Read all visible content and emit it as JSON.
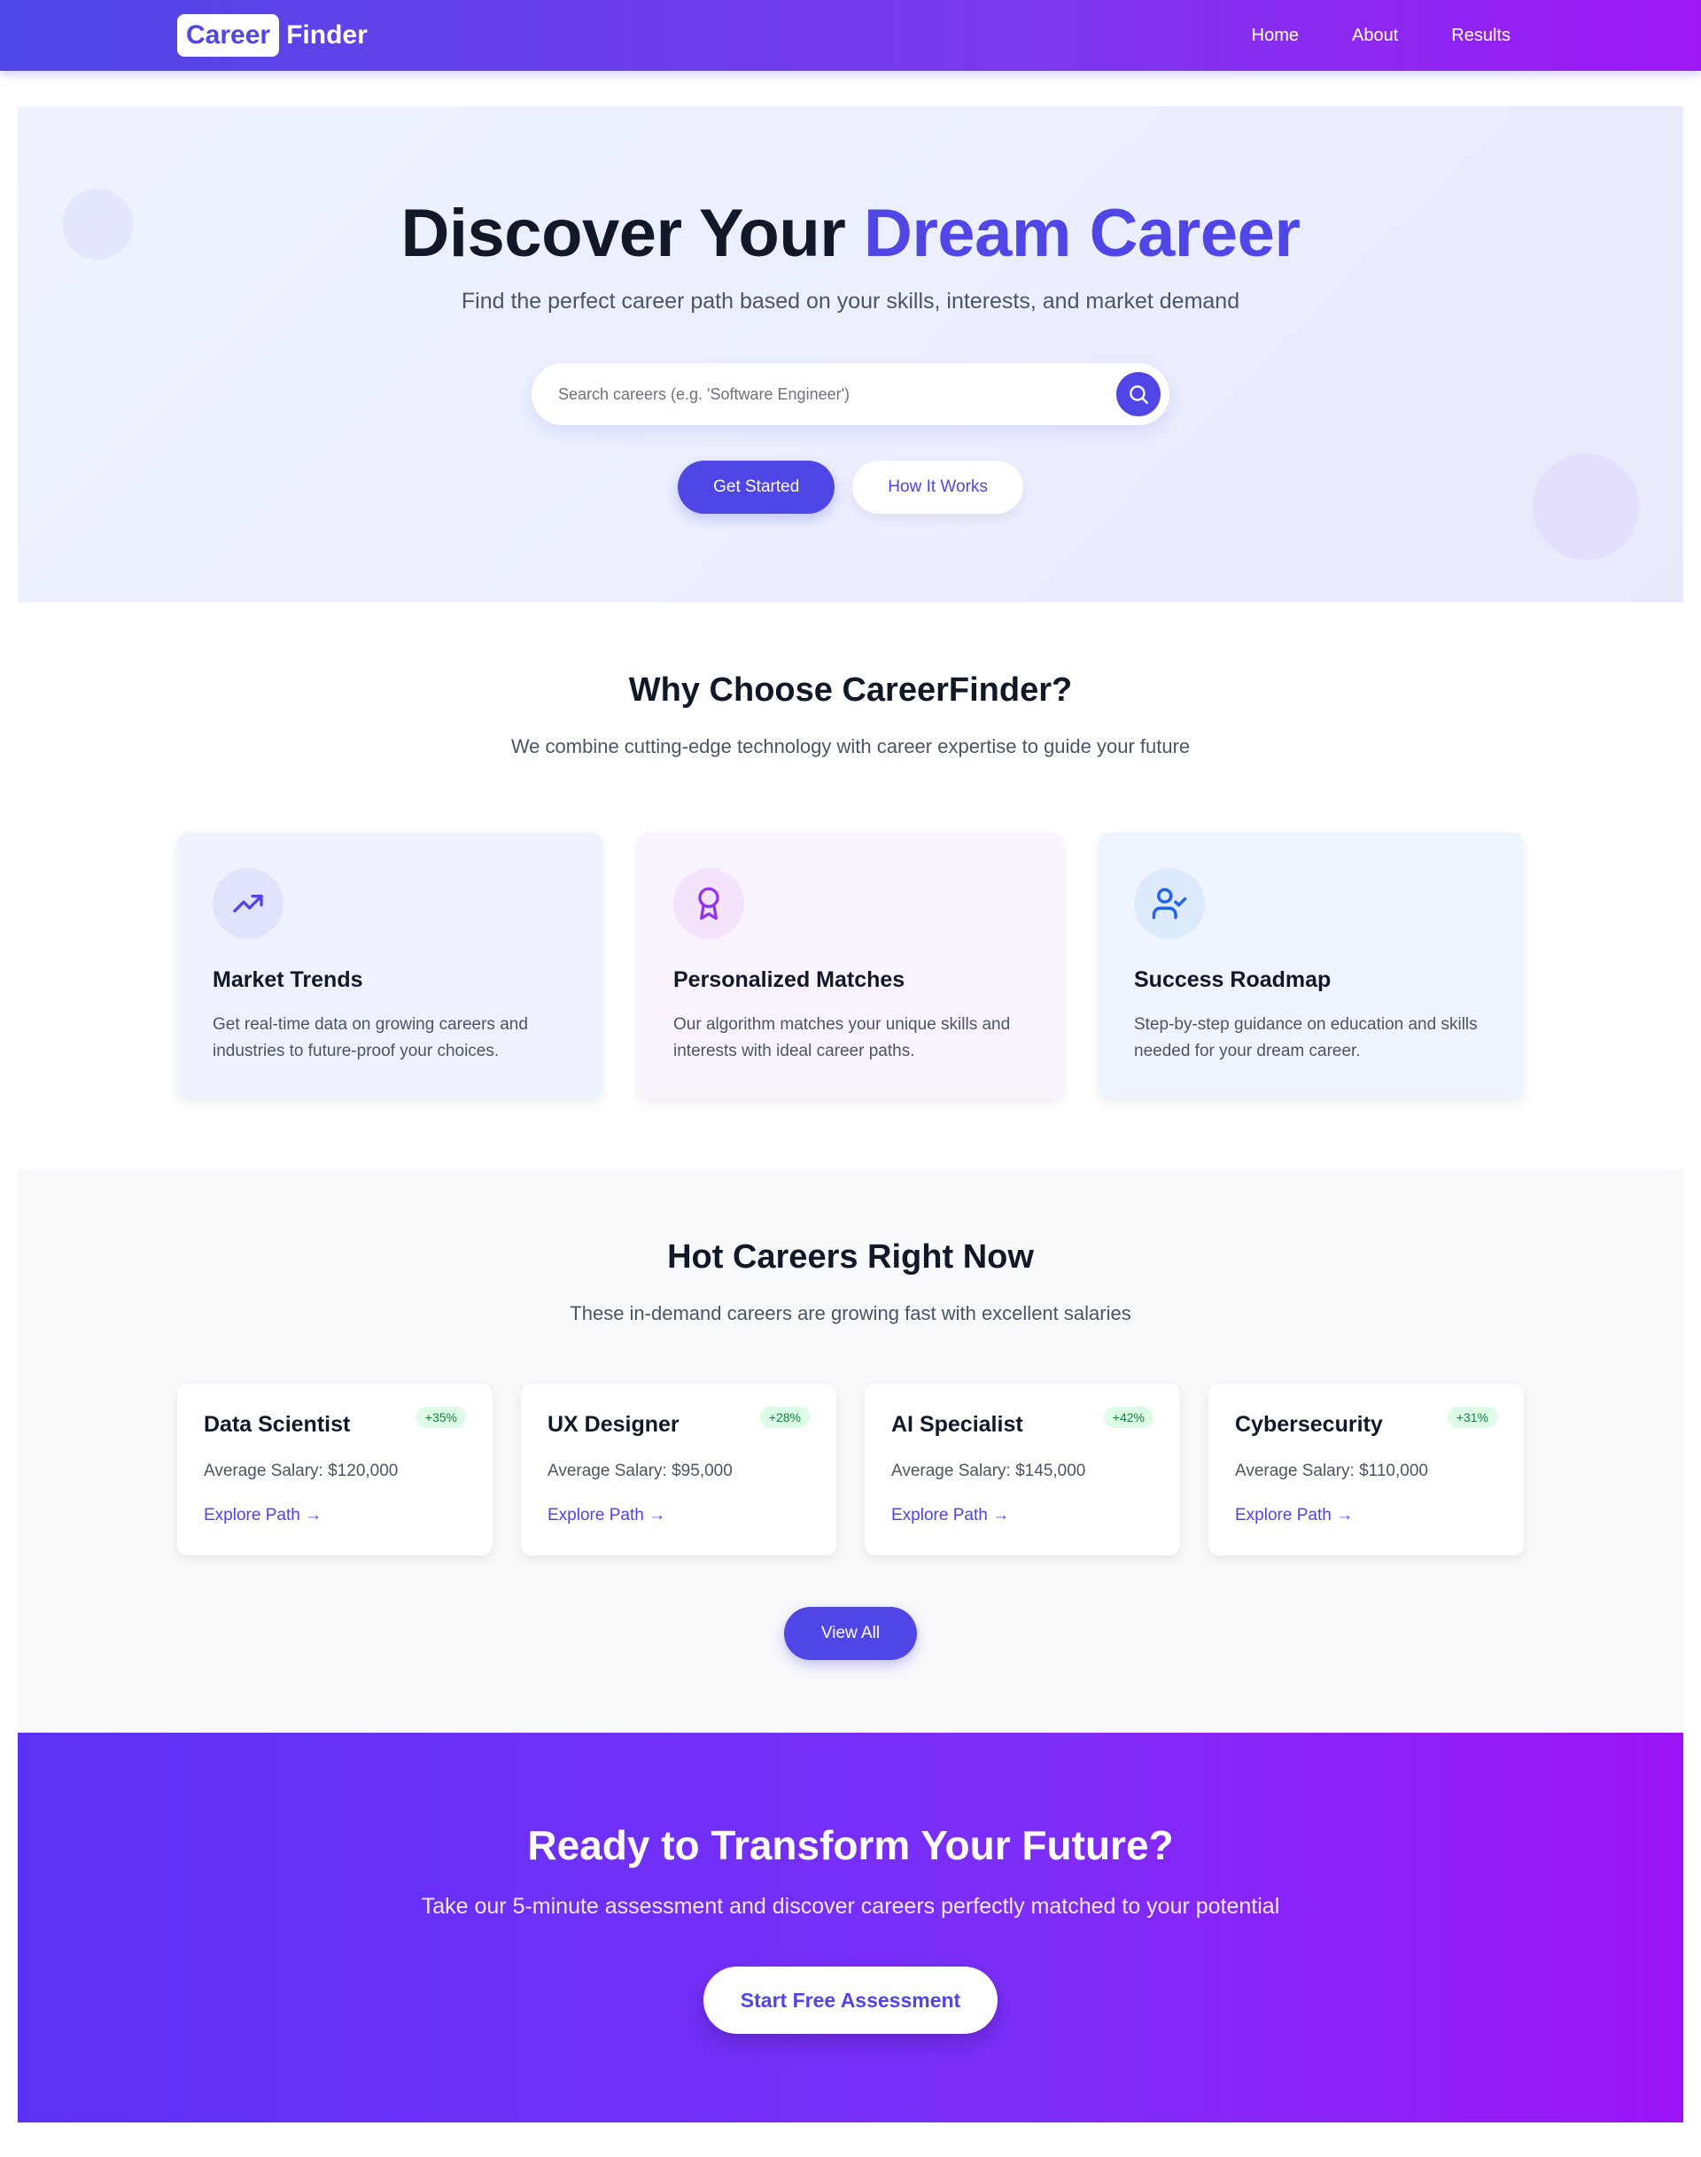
{
  "nav": {
    "logo_box": "Career",
    "logo_rest": "Finder",
    "links": [
      "Home",
      "About",
      "Results"
    ]
  },
  "hero": {
    "title_plain": "Discover Your ",
    "title_accent": "Dream Career",
    "subtitle": "Find the perfect career path based on your skills, interests, and market demand",
    "search_placeholder": "Search careers (e.g. 'Software Engineer')",
    "primary_button": "Get Started",
    "secondary_button": "How It Works"
  },
  "why": {
    "title": "Why Choose CareerFinder?",
    "subtitle": "We combine cutting-edge technology with career expertise to guide your future",
    "features": [
      {
        "title": "Market Trends",
        "desc": "Get real-time data on growing careers and industries to future-proof your choices.",
        "icon": "trending-up-icon"
      },
      {
        "title": "Personalized Matches",
        "desc": "Our algorithm matches your unique skills and interests with ideal career paths.",
        "icon": "award-icon"
      },
      {
        "title": "Success Roadmap",
        "desc": "Step-by-step guidance on education and skills needed for your dream career.",
        "icon": "user-check-icon"
      }
    ]
  },
  "hot": {
    "title": "Hot Careers Right Now",
    "subtitle": "These in-demand careers are growing fast with excellent salaries",
    "careers": [
      {
        "title": "Data Scientist",
        "growth": "+35%",
        "salary": "Average Salary: $120,000",
        "link": "Explore Path →"
      },
      {
        "title": "UX Designer",
        "growth": "+28%",
        "salary": "Average Salary: $95,000",
        "link": "Explore Path →"
      },
      {
        "title": "AI Specialist",
        "growth": "+42%",
        "salary": "Average Salary: $145,000",
        "link": "Explore Path →"
      },
      {
        "title": "Cybersecurity",
        "growth": "+31%",
        "salary": "Average Salary: $110,000",
        "link": "Explore Path →"
      }
    ],
    "view_all": "View All"
  },
  "cta": {
    "title": "Ready to Transform Your Future?",
    "subtitle": "Take our 5-minute assessment and discover careers perfectly matched to your potential",
    "button": "Start Free Assessment"
  },
  "colors": {
    "accent": "#4f46e5",
    "purple": "#9333ea",
    "blue": "#2563eb",
    "badge_green": "#15803d"
  }
}
